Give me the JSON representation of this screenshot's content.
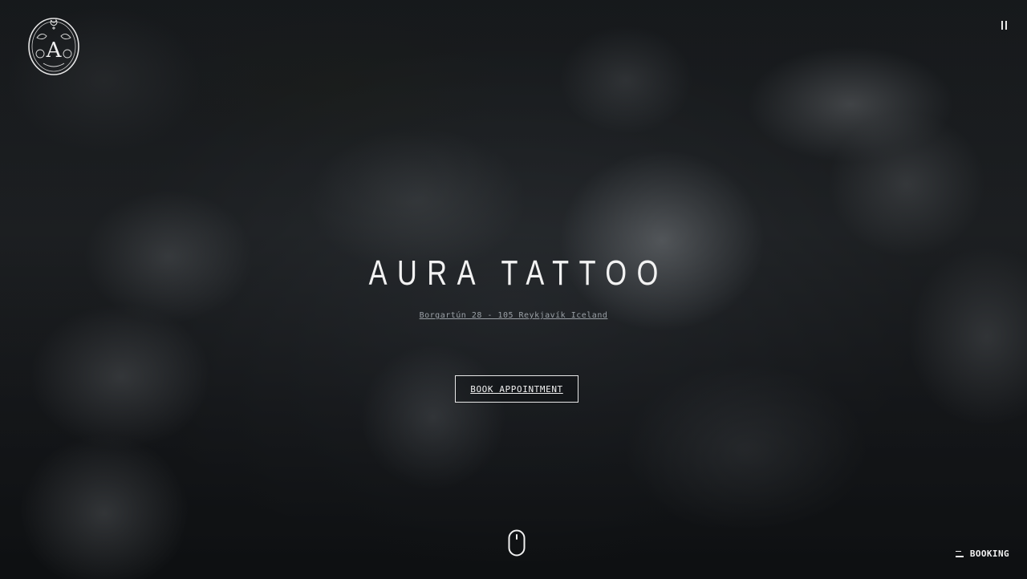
{
  "brand": {
    "title": "AURA TATTOO",
    "logo_icon": "aura-crest-icon",
    "logo_letter": "A"
  },
  "header": {
    "pause_icon": "pause-icon"
  },
  "hero": {
    "address": "Borgartún 28 - 105 Reykjavík Iceland",
    "book_button": "BOOK APPOINTMENT",
    "scroll_icon": "mouse-scroll-icon"
  },
  "footer": {
    "booking_label": "BOOKING",
    "booking_icon": "menu-lines-icon"
  },
  "colors": {
    "text": "#f2f2f2",
    "muted": "#9aa0a6",
    "background": "#22262a"
  }
}
